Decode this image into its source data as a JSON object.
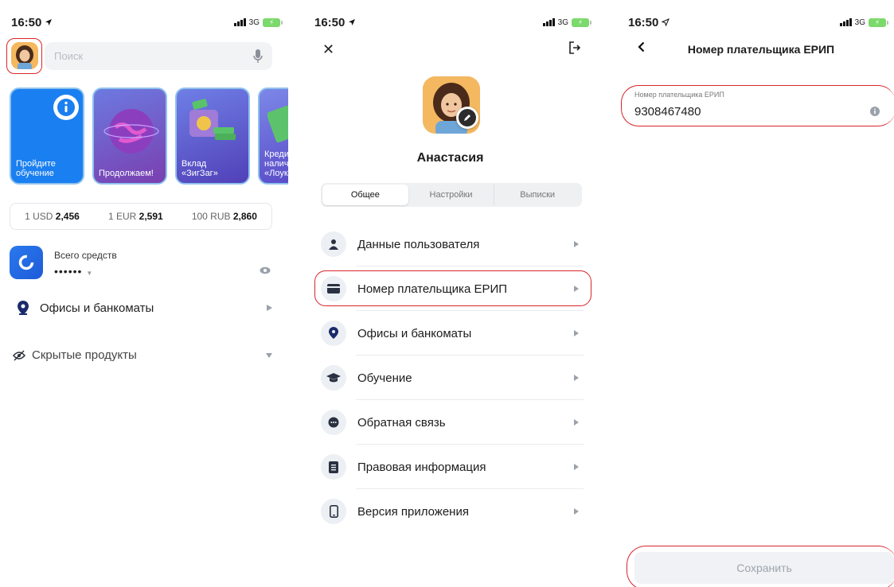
{
  "status_bar": {
    "time": "16:50",
    "network": "3G"
  },
  "home": {
    "search_placeholder": "Поиск",
    "stories": [
      {
        "caption": "Пройдите\nобучение",
        "bg": "#1a7ff0"
      },
      {
        "caption": "Продолжаем!",
        "bg": "#6a56c7"
      },
      {
        "caption": "Вклад\n«ЗигЗаг»",
        "bg": "#5a4fc4"
      },
      {
        "caption": "Креди\nналич\n«Лоук",
        "bg": "#6a5fd0"
      }
    ],
    "rates": [
      {
        "label": "1 USD",
        "value": "2,456"
      },
      {
        "label": "1 EUR",
        "value": "2,591"
      },
      {
        "label": "100 RUB",
        "value": "2,860"
      }
    ],
    "total_label": "Всего средств",
    "total_masked": "••••••",
    "offices_label": "Офисы и банкоматы",
    "hidden_label": "Скрытые продукты"
  },
  "profile": {
    "username": "Анастасия",
    "tabs": [
      "Общее",
      "Настройки",
      "Выписки"
    ],
    "menu": [
      {
        "label": "Данные пользователя",
        "icon": "user-icon"
      },
      {
        "label": "Номер плательщика ЕРИП",
        "icon": "card-icon"
      },
      {
        "label": "Офисы и банкоматы",
        "icon": "location-pin-icon"
      },
      {
        "label": "Обучение",
        "icon": "graduation-cap-icon"
      },
      {
        "label": "Обратная связь",
        "icon": "chat-bubble-icon"
      },
      {
        "label": "Правовая информация",
        "icon": "document-icon"
      },
      {
        "label": "Версия приложения",
        "icon": "phone-icon"
      }
    ]
  },
  "erip": {
    "title": "Номер плательщика ЕРИП",
    "field_label": "Номер плательщика ЕРИП",
    "field_value": "9308467480",
    "save_label": "Сохранить"
  },
  "colors": {
    "highlight": "#d9252b",
    "accent": "#1a7ff0"
  }
}
